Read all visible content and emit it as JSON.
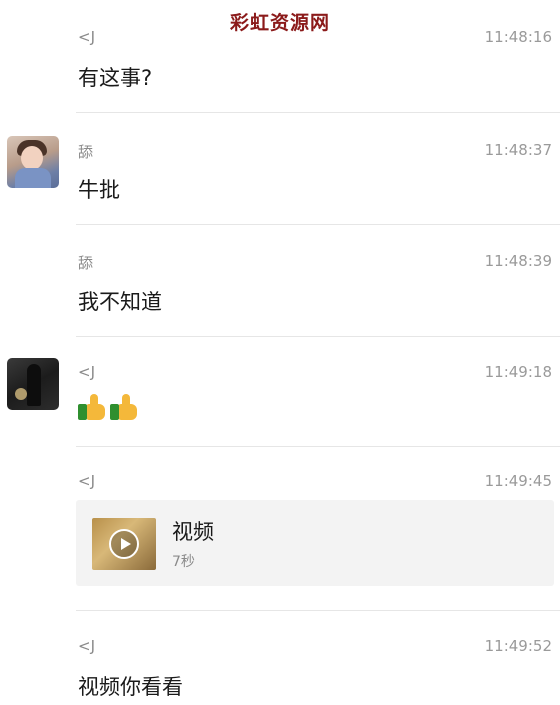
{
  "watermark": "彩虹资源网",
  "messages": [
    {
      "sender": "<J",
      "time": "11:48:16",
      "text": "有这事?"
    },
    {
      "sender": "舔",
      "time": "11:48:37",
      "text": "牛批"
    },
    {
      "sender": "舔",
      "time": "11:48:39",
      "text": "我不知道"
    },
    {
      "sender": "<J",
      "time": "11:49:18",
      "emoji": [
        "thumbs-up",
        "thumbs-up"
      ]
    },
    {
      "sender": "<J",
      "time": "11:49:45",
      "video": {
        "title": "视频",
        "duration": "7秒"
      }
    },
    {
      "sender": "<J",
      "time": "11:49:52",
      "text": "视频你看看"
    }
  ]
}
